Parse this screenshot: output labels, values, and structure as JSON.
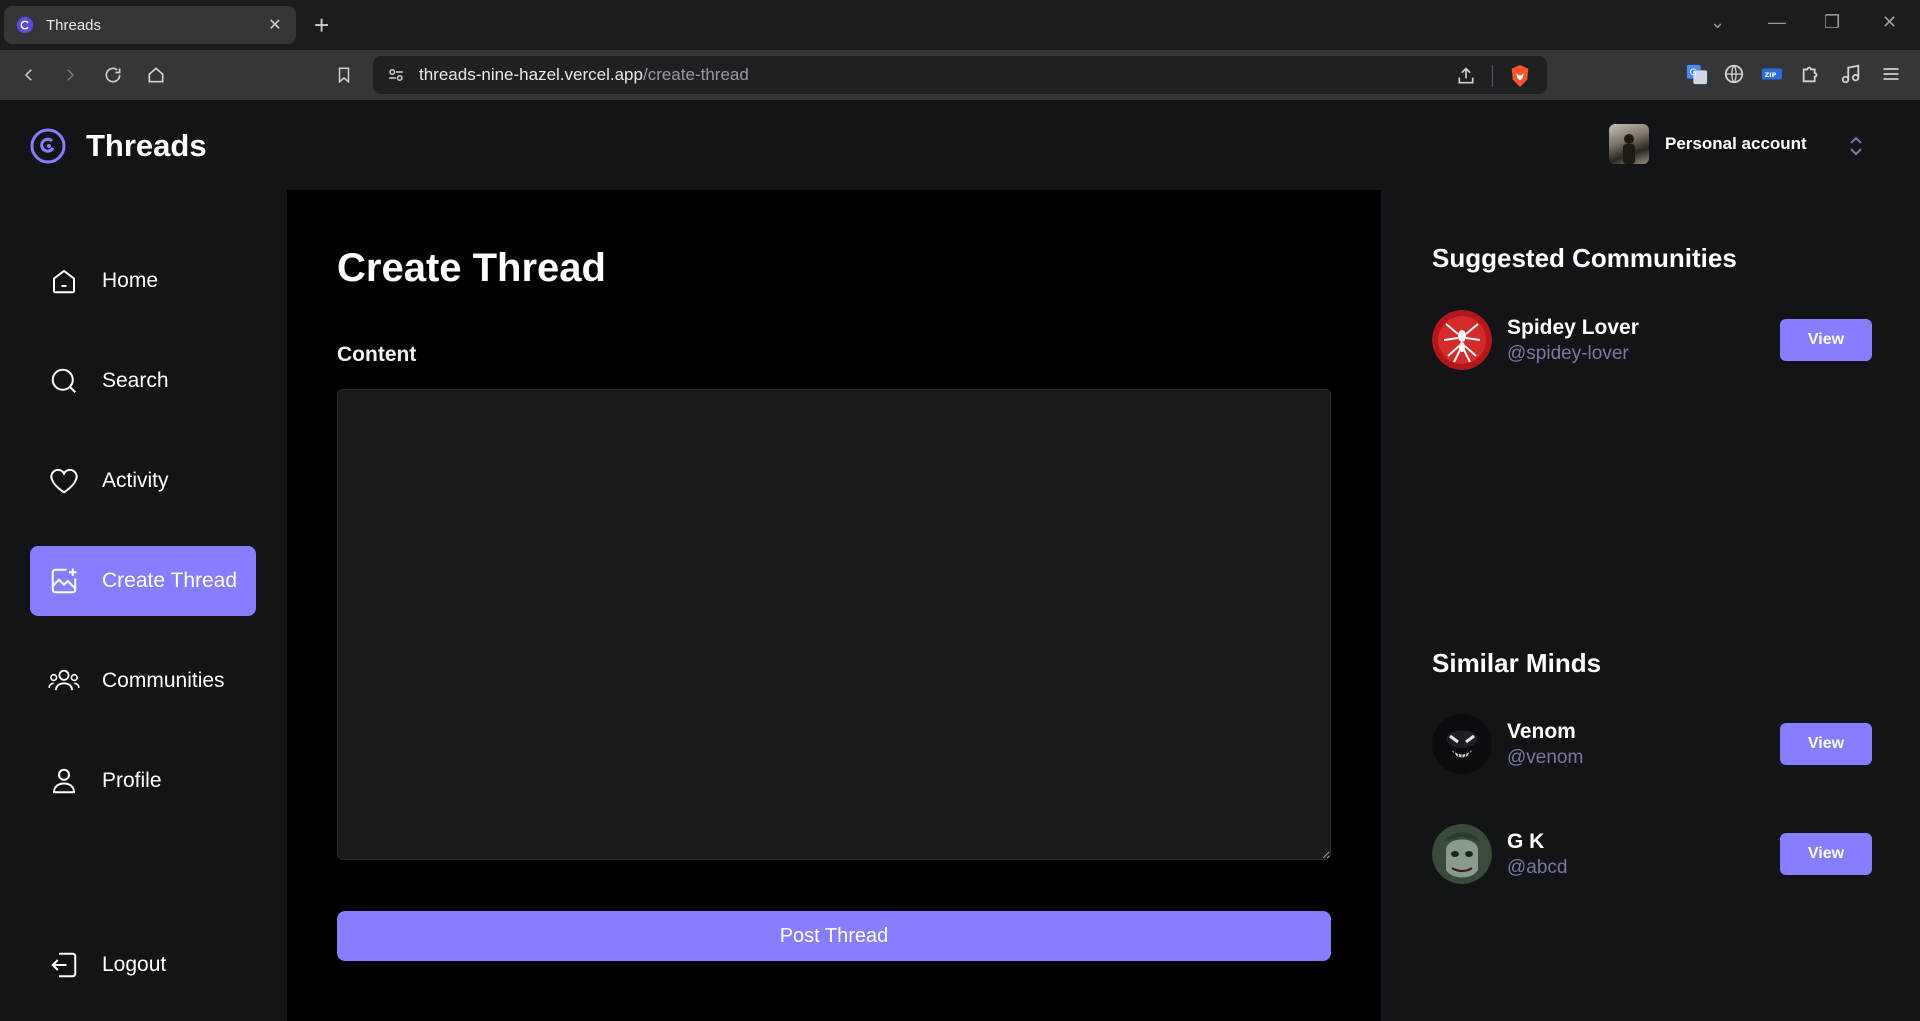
{
  "browser": {
    "tab_title": "Threads",
    "url_host": "threads-nine-hazel.vercel.app",
    "url_path": "/create-thread"
  },
  "app": {
    "brand": "Threads",
    "account_name": "Personal account"
  },
  "sidebar": {
    "items": [
      {
        "label": "Home",
        "icon": "home-icon"
      },
      {
        "label": "Search",
        "icon": "search-icon"
      },
      {
        "label": "Activity",
        "icon": "heart-icon"
      },
      {
        "label": "Create Thread",
        "icon": "create-thread-icon",
        "active": true
      },
      {
        "label": "Communities",
        "icon": "communities-icon"
      },
      {
        "label": "Profile",
        "icon": "user-icon"
      }
    ],
    "logout": "Logout"
  },
  "main": {
    "title": "Create Thread",
    "content_label": "Content",
    "content_value": "",
    "post_button": "Post Thread"
  },
  "rightbar": {
    "communities_title": "Suggested Communities",
    "communities": [
      {
        "name": "Spidey Lover",
        "handle": "@spidey-lover",
        "button": "View"
      }
    ],
    "users_title": "Similar Minds",
    "users": [
      {
        "name": "Venom",
        "handle": "@venom",
        "button": "View"
      },
      {
        "name": "G K",
        "handle": "@abcd",
        "button": "View"
      }
    ]
  },
  "colors": {
    "accent": "#877eff",
    "background": "#121417",
    "main_background": "#000000",
    "handle_text": "#7878a3"
  }
}
